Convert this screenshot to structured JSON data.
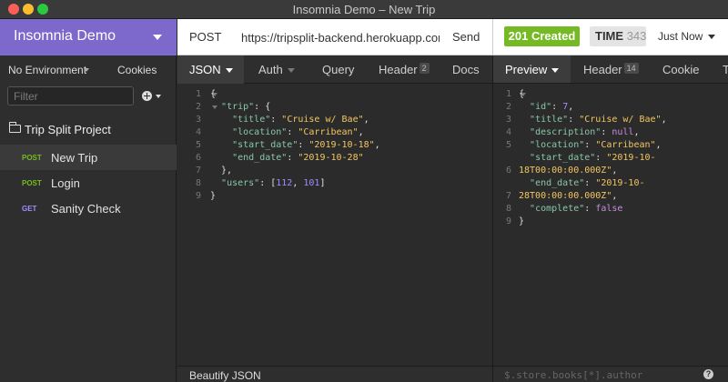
{
  "window": {
    "title": "Insomnia Demo – New Trip"
  },
  "sidebar": {
    "workspace": "Insomnia Demo",
    "environment": "No Environment",
    "cookies_label": "Cookies",
    "filter_placeholder": "Filter",
    "project": "Trip Split Project",
    "requests": [
      {
        "method": "POST",
        "name": "New Trip"
      },
      {
        "method": "POST",
        "name": "Login"
      },
      {
        "method": "GET",
        "name": "Sanity Check"
      }
    ]
  },
  "request": {
    "method": "POST",
    "url": "https://tripsplit-backend.herokuapp.com/",
    "send_label": "Send",
    "tabs": {
      "json": "JSON",
      "auth": "Auth",
      "query": "Query",
      "header": "Header",
      "header_count": "2",
      "docs": "Docs"
    },
    "body_lines": [
      "1",
      "2",
      "3",
      "4",
      "5",
      "6",
      "7",
      "8",
      "9"
    ],
    "body": {
      "trip_key": "\"trip\"",
      "title_key": "\"title\"",
      "title_val": "\"Cruise w/ Bae\"",
      "location_key": "\"location\"",
      "location_val": "\"Carribean\"",
      "start_key": "\"start_date\"",
      "start_val": "\"2019-10-18\"",
      "end_key": "\"end_date\"",
      "end_val": "\"2019-10-28\"",
      "users_key": "\"users\"",
      "users_a": "112",
      "users_b": "101"
    },
    "beautify_label": "Beautify JSON"
  },
  "response": {
    "status": "201 Created",
    "time_label": "TIME",
    "time_value": "343",
    "just_now": "Just Now",
    "tabs": {
      "preview": "Preview",
      "header": "Header",
      "header_count": "14",
      "cookie": "Cookie",
      "timeline": "T"
    },
    "body_lines": [
      "1",
      "2",
      "3",
      "4",
      "5",
      "",
      "6",
      "",
      "7",
      "8",
      "9"
    ],
    "body": {
      "id_key": "\"id\"",
      "id_val": "7",
      "title_key": "\"title\"",
      "title_val": "\"Cruise w/ Bae\"",
      "desc_key": "\"description\"",
      "desc_val": "null",
      "location_key": "\"location\"",
      "location_val": "\"Carribean\"",
      "start_key": "\"start_date\"",
      "start_val_a": "\"2019-10-",
      "start_val_b": "18T00:00:00.000Z\"",
      "end_key": "\"end_date\"",
      "end_val_a": "\"2019-10-",
      "end_val_b": "28T00:00:00.000Z\"",
      "complete_key": "\"complete\"",
      "complete_val": "false"
    },
    "filter_text": "$.store.books[*].author",
    "help_icon": "?"
  },
  "colors": {
    "workspace_header": "#7d69cb",
    "post": "#75ba24",
    "get": "#a18dff",
    "status_success": "#75ba24",
    "json_string": "#f2c660",
    "json_key": "#8ac7a8",
    "json_number": "#a18dff"
  }
}
